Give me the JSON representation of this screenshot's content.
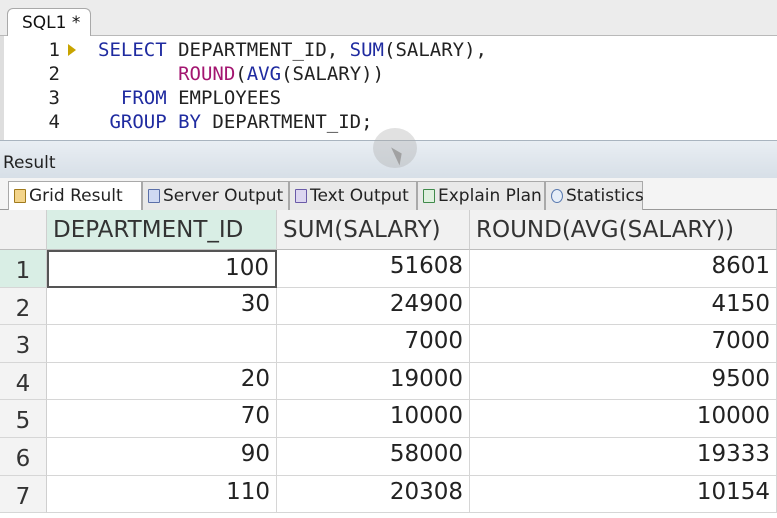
{
  "editor": {
    "tab_label": "SQL1 *",
    "lines": [
      {
        "number": "1",
        "parts": [
          {
            "t": "SELECT",
            "c": "kw"
          },
          {
            "t": " DEPARTMENT_ID, ",
            "c": ""
          },
          {
            "t": "SUM",
            "c": "kw"
          },
          {
            "t": "(SALARY),",
            "c": ""
          }
        ]
      },
      {
        "number": "2",
        "parts": [
          {
            "t": "       ",
            "c": ""
          },
          {
            "t": "ROUND",
            "c": "fn"
          },
          {
            "t": "(",
            "c": ""
          },
          {
            "t": "AVG",
            "c": "kw"
          },
          {
            "t": "(SALARY))",
            "c": ""
          }
        ]
      },
      {
        "number": "3",
        "parts": [
          {
            "t": "  ",
            "c": ""
          },
          {
            "t": "FROM",
            "c": "kw"
          },
          {
            "t": " EMPLOYEES",
            "c": ""
          }
        ]
      },
      {
        "number": "4",
        "parts": [
          {
            "t": " ",
            "c": ""
          },
          {
            "t": "GROUP BY",
            "c": "kw"
          },
          {
            "t": " DEPARTMENT_ID;",
            "c": ""
          }
        ]
      }
    ]
  },
  "result": {
    "title": "Result",
    "tabs": [
      {
        "label": "Grid Result",
        "icon": "grid-icon"
      },
      {
        "label": "Server Output",
        "icon": "server-output-icon"
      },
      {
        "label": "Text Output",
        "icon": "text-output-icon"
      },
      {
        "label": "Explain Plan",
        "icon": "explain-plan-icon"
      },
      {
        "label": "Statistics",
        "icon": "statistics-icon"
      }
    ],
    "active_tab": 0
  },
  "grid": {
    "columns": [
      "DEPARTMENT_ID",
      "SUM(SALARY)",
      "ROUND(AVG(SALARY))"
    ],
    "rows": [
      {
        "n": "1",
        "cells": [
          "100",
          "51608",
          "8601"
        ]
      },
      {
        "n": "2",
        "cells": [
          "30",
          "24900",
          "4150"
        ]
      },
      {
        "n": "3",
        "cells": [
          "",
          "7000",
          "7000"
        ]
      },
      {
        "n": "4",
        "cells": [
          "20",
          "19000",
          "9500"
        ]
      },
      {
        "n": "5",
        "cells": [
          "70",
          "10000",
          "10000"
        ]
      },
      {
        "n": "6",
        "cells": [
          "90",
          "58000",
          "19333"
        ]
      },
      {
        "n": "7",
        "cells": [
          "110",
          "20308",
          "10154"
        ]
      }
    ],
    "selected_row": 0,
    "selected_column": 0
  }
}
